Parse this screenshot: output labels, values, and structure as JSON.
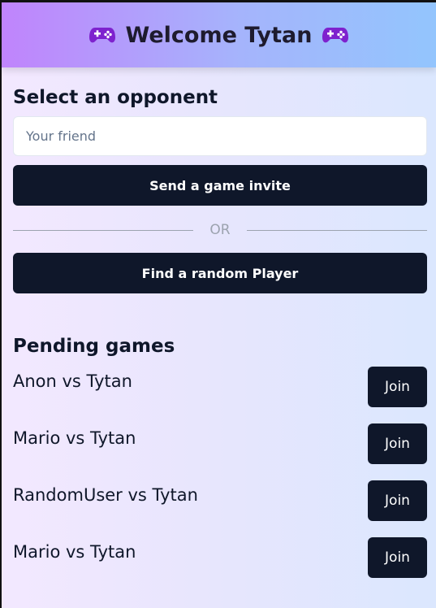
{
  "header": {
    "title": "Welcome Tytan",
    "left_icon": "gamepad-icon",
    "right_icon": "gamepad-icon"
  },
  "opponent": {
    "title": "Select an opponent",
    "input_placeholder": "Your friend",
    "input_value": "",
    "invite_button": "Send a game invite",
    "or_label": "OR",
    "random_button": "Find a random Player"
  },
  "pending": {
    "title": "Pending games",
    "games": [
      {
        "label": "Anon vs Tytan",
        "button": "Join"
      },
      {
        "label": "Mario vs Tytan",
        "button": "Join"
      },
      {
        "label": "RandomUser vs Tytan",
        "button": "Join"
      },
      {
        "label": "Mario vs Tytan",
        "button": "Join"
      }
    ]
  },
  "colors": {
    "primary_button": "#0f172a",
    "header_gradient_start": "#c084fc",
    "header_gradient_end": "#93c5fd",
    "icon_purple": "#7e22ce"
  }
}
